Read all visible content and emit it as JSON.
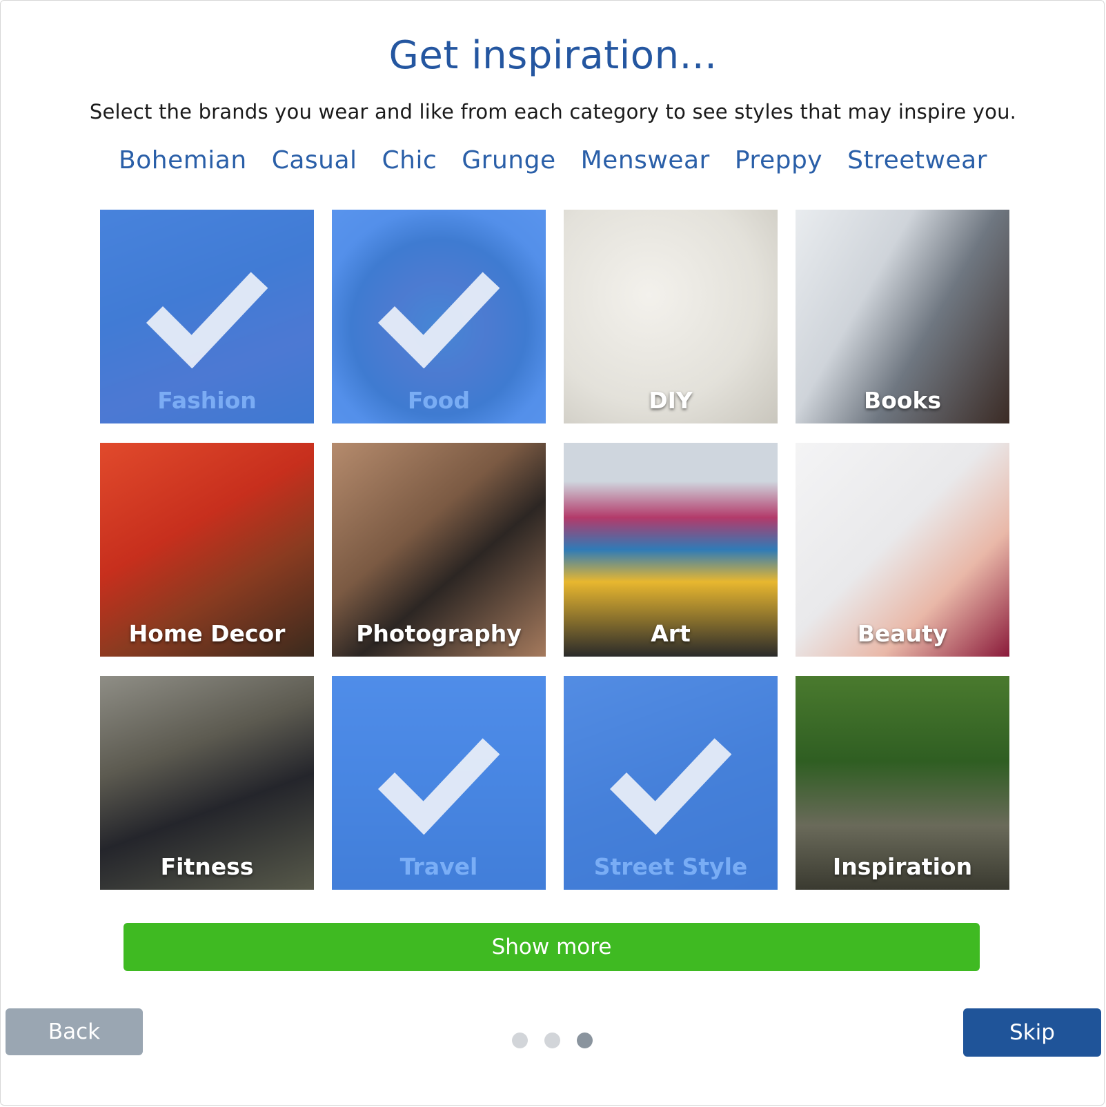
{
  "header": {
    "title": "Get inspiration...",
    "subtitle": "Select the brands you wear and like from each category to see styles that may inspire you."
  },
  "styles": [
    "Bohemian",
    "Casual",
    "Chic",
    "Grunge",
    "Menswear",
    "Preppy",
    "Streetwear"
  ],
  "tiles": [
    {
      "label": "Fashion",
      "selected": true,
      "photo": "p-fashion"
    },
    {
      "label": "Food",
      "selected": true,
      "photo": "p-food"
    },
    {
      "label": "DIY",
      "selected": false,
      "photo": "p-diy"
    },
    {
      "label": "Books",
      "selected": false,
      "photo": "p-books"
    },
    {
      "label": "Home Decor",
      "selected": false,
      "photo": "p-home"
    },
    {
      "label": "Photography",
      "selected": false,
      "photo": "p-photo"
    },
    {
      "label": "Art",
      "selected": false,
      "photo": "p-art"
    },
    {
      "label": "Beauty",
      "selected": false,
      "photo": "p-beauty"
    },
    {
      "label": "Fitness",
      "selected": false,
      "photo": "p-fitness"
    },
    {
      "label": "Travel",
      "selected": true,
      "photo": "p-travel"
    },
    {
      "label": "Street Style",
      "selected": true,
      "photo": "p-street"
    },
    {
      "label": "Inspiration",
      "selected": false,
      "photo": "p-inspo"
    }
  ],
  "actions": {
    "show_more": "Show more",
    "back": "Back",
    "skip": "Skip"
  },
  "pagination": {
    "total": 3,
    "current": 3
  },
  "colors": {
    "accent": "#2456a0",
    "selected_overlay": "#4286ec",
    "show_more_bg": "#3fba22",
    "skip_bg": "#1f5499",
    "back_bg": "#9aa6b2"
  }
}
